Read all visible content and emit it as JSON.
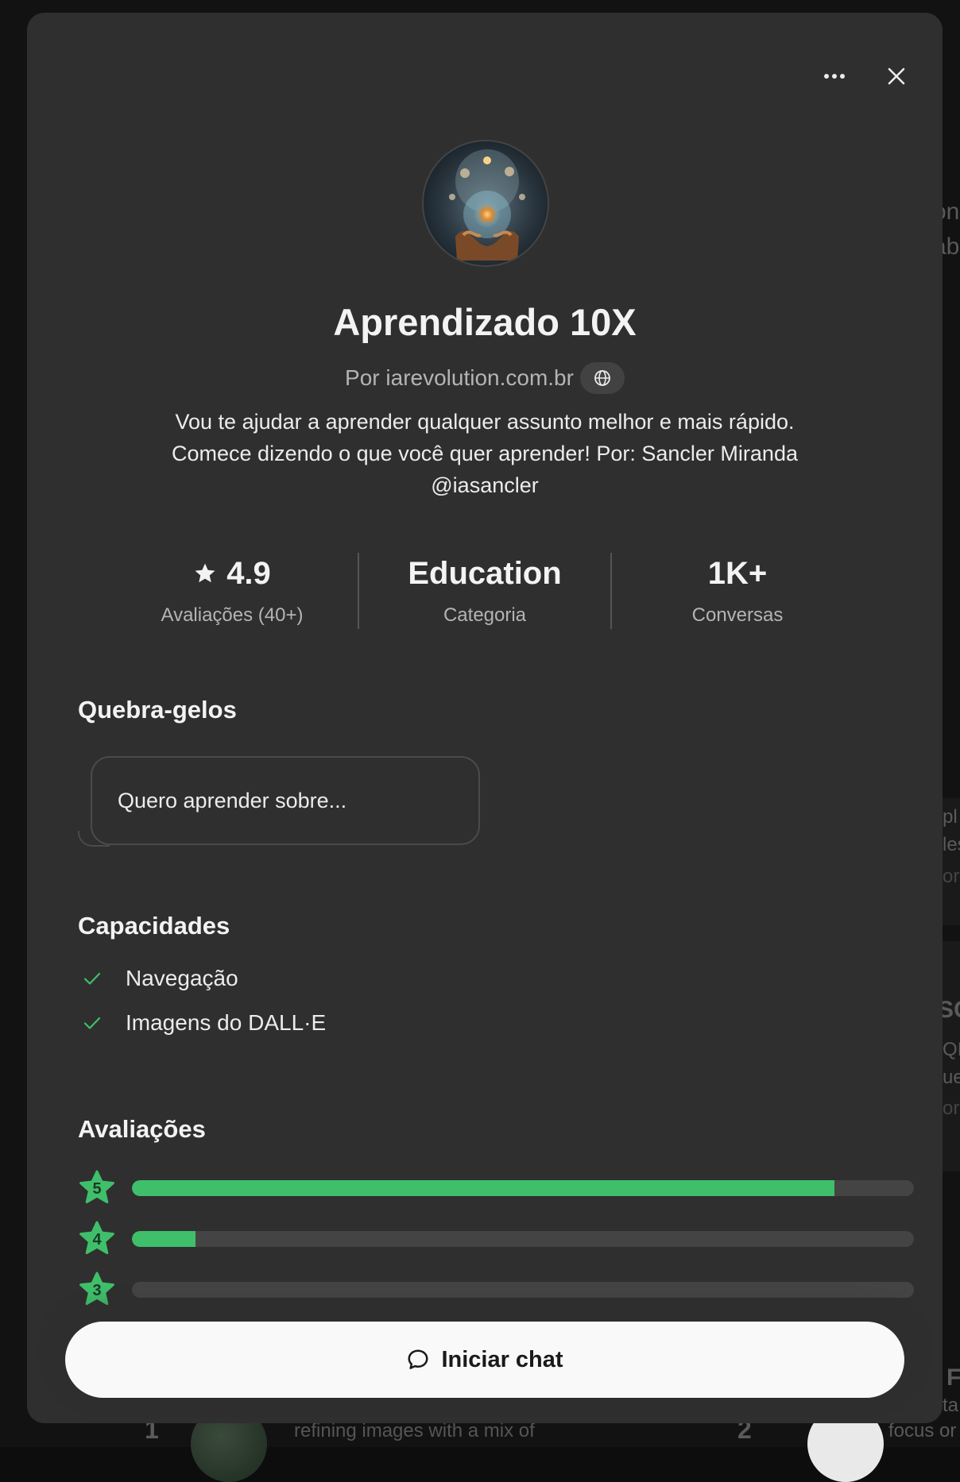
{
  "background": {
    "fragments": [
      "on",
      "ab",
      "pl",
      "les",
      "or",
      "SC",
      "QI",
      "ue",
      "or",
      "e F",
      "ta",
      "focus or"
    ],
    "bottom_text": "refining images with a mix of",
    "list_numbers": [
      "1",
      "2"
    ]
  },
  "modal": {
    "more_icon": "more-horizontal-icon",
    "close_icon": "close-icon"
  },
  "gpt": {
    "name": "Aprendizado 10X",
    "byline": "Por iarevolution.com.br",
    "description": "Vou te ajudar a aprender qualquer assunto melhor e mais rápido. Comece dizendo o que você quer aprender! Por: Sancler Miranda @iasancler"
  },
  "stats": [
    {
      "value": "4.9",
      "label": "Avaliações (40+)",
      "icon": "star-icon"
    },
    {
      "value": "Education",
      "label": "Categoria"
    },
    {
      "value": "1K+",
      "label": "Conversas"
    }
  ],
  "conversation_starters": {
    "title": "Quebra-gelos",
    "items": [
      "Quero aprender sobre..."
    ]
  },
  "capabilities": {
    "title": "Capacidades",
    "items": [
      "Navegação",
      "Imagens do DALL·E"
    ]
  },
  "ratings": {
    "title": "Avaliações",
    "rows": [
      {
        "stars": "5",
        "fraction": 0.898
      },
      {
        "stars": "4",
        "fraction": 0.081
      },
      {
        "stars": "3",
        "fraction": 0.0
      }
    ],
    "accent": "#3fbf6a"
  },
  "cta": {
    "label": "Iniciar chat",
    "icon": "chat-bubble-icon"
  }
}
